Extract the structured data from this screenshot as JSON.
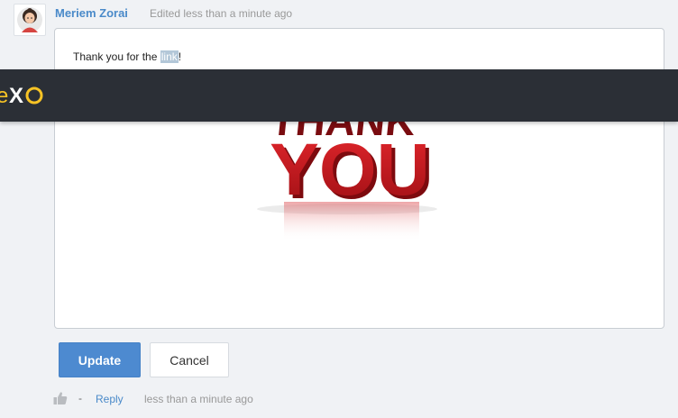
{
  "comment": {
    "author": "Meriem Zorai",
    "edited": "Edited less than a minute ago",
    "text_before": "Thank you for the ",
    "text_selected": "link",
    "text_after": "!"
  },
  "image": {
    "line1": "THANK",
    "line2": "YOU"
  },
  "toolbar": {
    "logo_text": "eXo"
  },
  "actions": {
    "update_label": "Update",
    "cancel_label": "Cancel"
  },
  "footer": {
    "separator": "-",
    "reply_label": "Reply",
    "timestamp": "less than a minute ago"
  },
  "colors": {
    "accent": "#4a8ac9",
    "update_button": "#4d8ad0",
    "toolbar": "#2b2f36",
    "logo_yellow": "#f7c325",
    "image_red": "#c4161c"
  }
}
